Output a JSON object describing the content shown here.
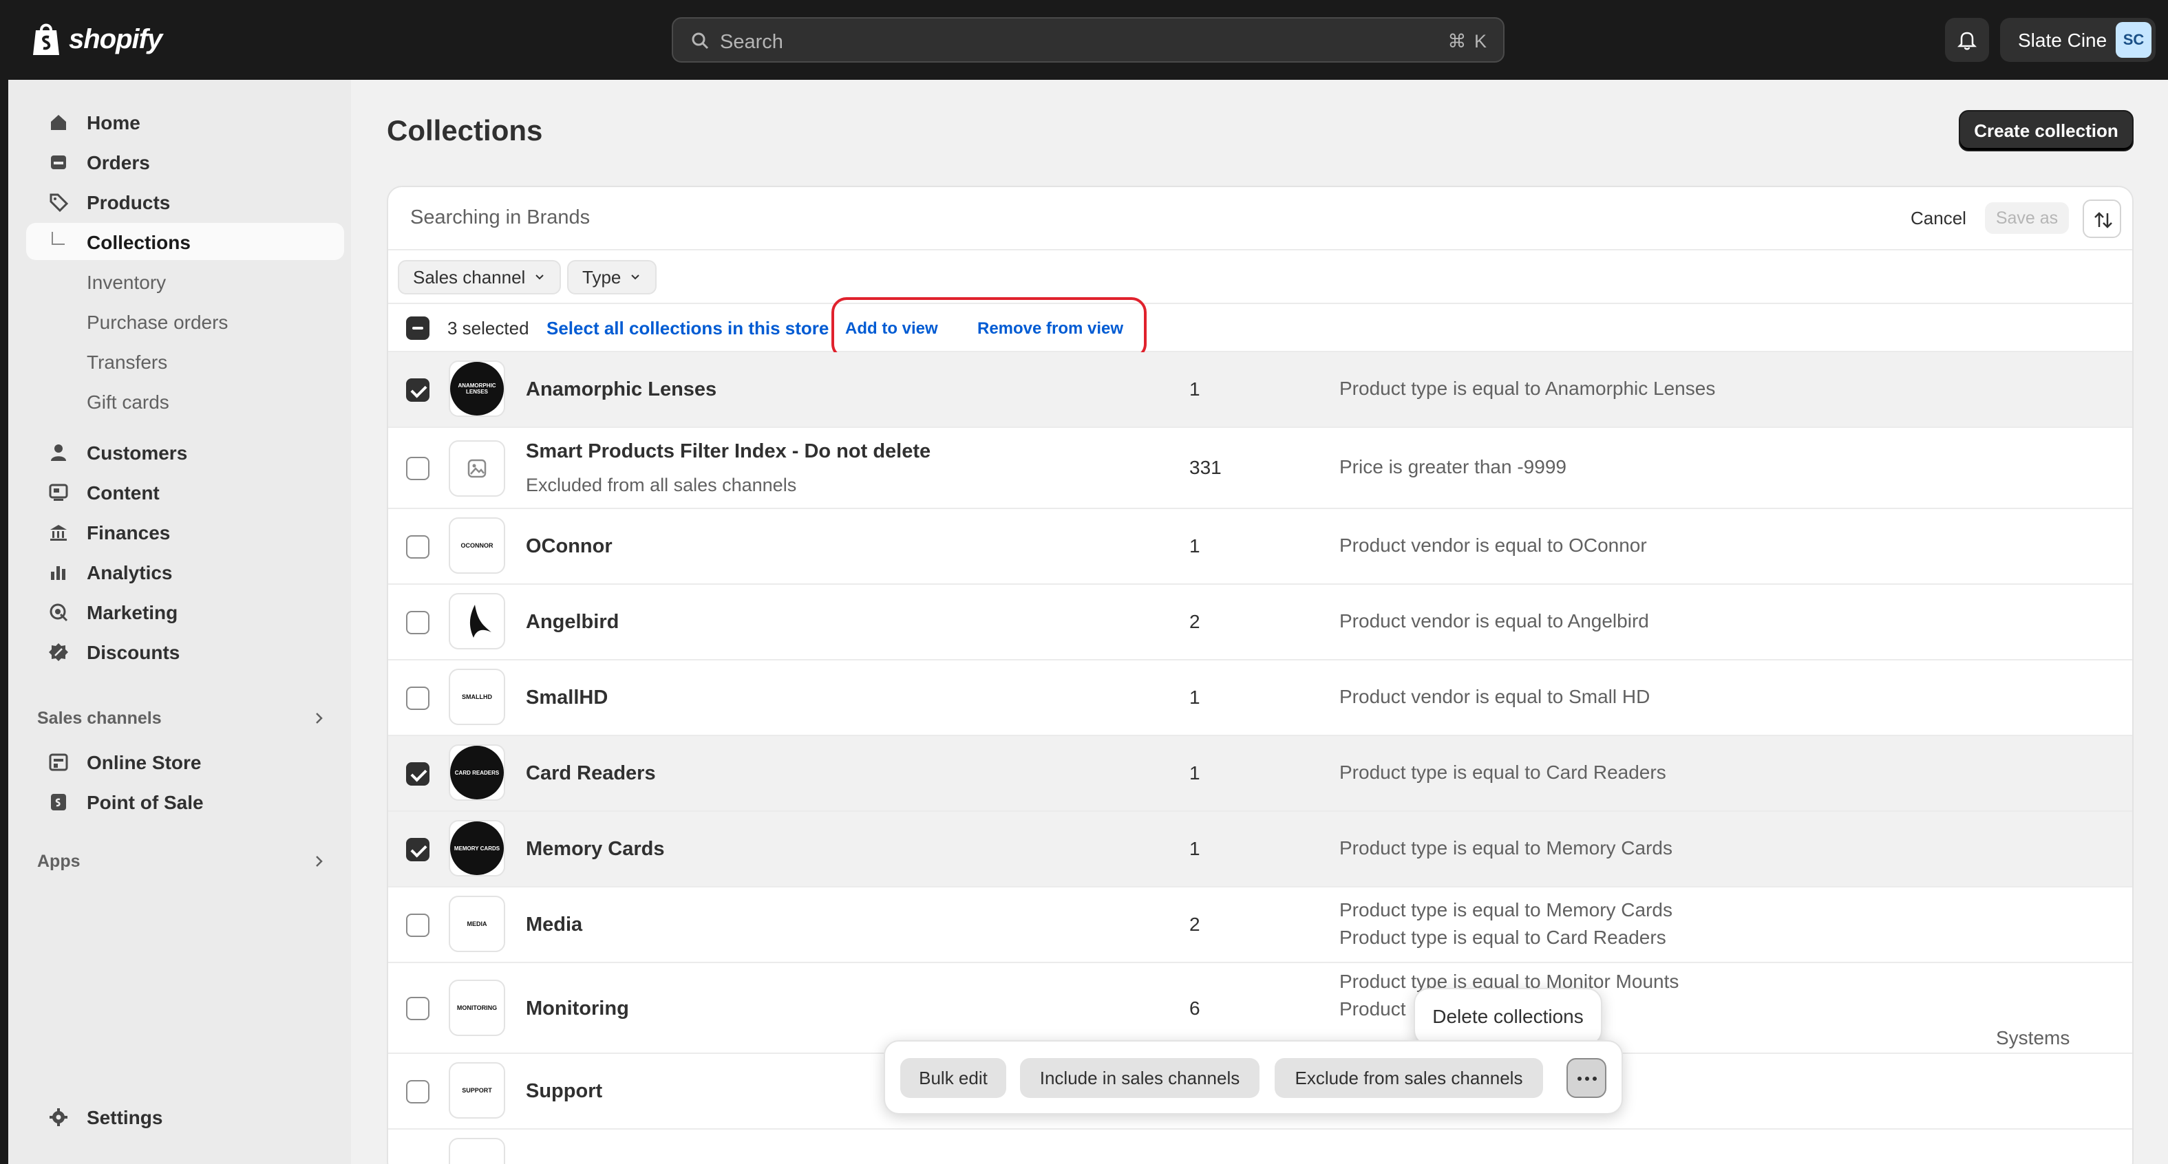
{
  "header": {
    "logo_text": "shopify",
    "search_placeholder": "Search",
    "search_shortcut": "⌘ K",
    "account_name": "Slate Cine",
    "account_initials": "SC"
  },
  "sidebar": {
    "items": [
      {
        "label": "Home",
        "icon": "home-icon"
      },
      {
        "label": "Orders",
        "icon": "orders-icon"
      },
      {
        "label": "Products",
        "icon": "tag-icon"
      },
      {
        "label": "Collections",
        "icon": "subitem-arrow-icon"
      },
      {
        "label": "Inventory"
      },
      {
        "label": "Purchase orders"
      },
      {
        "label": "Transfers"
      },
      {
        "label": "Gift cards"
      },
      {
        "label": "Customers",
        "icon": "person-icon"
      },
      {
        "label": "Content",
        "icon": "content-icon"
      },
      {
        "label": "Finances",
        "icon": "bank-icon"
      },
      {
        "label": "Analytics",
        "icon": "bar-chart-icon"
      },
      {
        "label": "Marketing",
        "icon": "target-icon"
      },
      {
        "label": "Discounts",
        "icon": "discount-icon"
      }
    ],
    "sales_channels_heading": "Sales channels",
    "sales_channels": [
      {
        "label": "Online Store",
        "icon": "store-icon"
      },
      {
        "label": "Point of Sale",
        "icon": "pos-icon"
      }
    ],
    "apps_heading": "Apps",
    "settings_label": "Settings"
  },
  "main": {
    "title": "Collections",
    "create_button": "Create collection",
    "filter": {
      "query": "Searching in Brands",
      "cancel": "Cancel",
      "save_as": "Save as"
    },
    "chips": [
      "Sales channel",
      "Type"
    ],
    "bulk": {
      "selected": "3 selected",
      "select_all": "Select all collections in this store",
      "add_to_view": "Add to view",
      "remove_from_view": "Remove from view"
    },
    "rows": [
      {
        "title": "Anamorphic Lenses",
        "subtitle": "",
        "count": "1",
        "conditions": [
          "Product type is equal to Anamorphic Lenses"
        ],
        "checked": true,
        "thumb": "ANAMORPHIC LENSES"
      },
      {
        "title": "Smart Products Filter Index - Do not delete",
        "subtitle": "Excluded from all sales channels",
        "count": "331",
        "conditions": [
          "Price is greater than -9999"
        ],
        "checked": false,
        "thumb": ""
      },
      {
        "title": "OConnor",
        "subtitle": "",
        "count": "1",
        "conditions": [
          "Product vendor is equal to OConnor"
        ],
        "checked": false,
        "thumb": "OCONNOR"
      },
      {
        "title": "Angelbird",
        "subtitle": "",
        "count": "2",
        "conditions": [
          "Product vendor is equal to Angelbird"
        ],
        "checked": false,
        "thumb": ""
      },
      {
        "title": "SmallHD",
        "subtitle": "",
        "count": "1",
        "conditions": [
          "Product vendor is equal to Small HD"
        ],
        "checked": false,
        "thumb": "SMALLHD"
      },
      {
        "title": "Card Readers",
        "subtitle": "",
        "count": "1",
        "conditions": [
          "Product type is equal to Card Readers"
        ],
        "checked": true,
        "thumb": "CARD READERS"
      },
      {
        "title": "Memory Cards",
        "subtitle": "",
        "count": "1",
        "conditions": [
          "Product type is equal to Memory Cards"
        ],
        "checked": true,
        "thumb": "MEMORY CARDS"
      },
      {
        "title": "Media",
        "subtitle": "",
        "count": "2",
        "conditions": [
          "Product type is equal to Memory Cards",
          "Product type is equal to Card Readers"
        ],
        "checked": false,
        "thumb": "MEDIA"
      },
      {
        "title": "Monitoring",
        "subtitle": "",
        "count": "6",
        "conditions": [
          "Product type is equal to Monitor Mounts",
          "Product",
          "Systems"
        ],
        "checked": false,
        "thumb": "MONITORING"
      },
      {
        "title": "Support",
        "subtitle": "",
        "count": "",
        "conditions": [],
        "checked": false,
        "thumb": "SUPPORT"
      }
    ],
    "action_bar": {
      "bulk_edit": "Bulk edit",
      "include": "Include in sales channels",
      "exclude": "Exclude from sales channels"
    },
    "popover_item": "Delete collections"
  },
  "colors": {
    "topbar": "#1a1a1a",
    "link": "#005bd3",
    "highlight": "#e0222d"
  }
}
